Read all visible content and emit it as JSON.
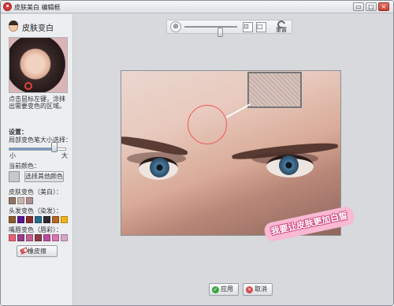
{
  "window": {
    "title": "皮肤美白 编辑框",
    "minimize": "▭",
    "maximize": "□",
    "close": "×"
  },
  "sidebar": {
    "title": "皮肤变白",
    "instruction": "点击鼠标左键，涂抹出需要变色的区域。",
    "settings_label": "设置：",
    "brush_size_label": "局部变色笔大小选择：",
    "brush_size_value": 0.85,
    "small_label": "小",
    "large_label": "大",
    "current_color_label": "当前颜色：",
    "current_color": "#c8c8c8",
    "other_color_button": "选择其他颜色",
    "skin_label": "皮肤变色（美白）：",
    "skin_colors": [
      "#8e7664",
      "#c9b6aa",
      "#ad8e93"
    ],
    "hair_label": "头发变色（染发）：",
    "hair_colors": [
      "#8b5b2c",
      "#5a1590",
      "#8d2c2c",
      "#246b8b",
      "#2f2a30",
      "#b56524",
      "#f0b21c"
    ],
    "lip_label": "嘴唇变色（唇彩）：",
    "lip_colors": [
      "#e46072",
      "#9a3e87",
      "#c5608f",
      "#8e3b4b",
      "#bc4c9f",
      "#da75b5",
      "#d4a7c7"
    ],
    "eraser_label": "橡皮擦"
  },
  "toolbar": {
    "zoom_in_icon": "⊕",
    "zoom_value": 0.7,
    "fit_icon": "⊡",
    "actual_icon": "□",
    "reset_label": "重置"
  },
  "photo": {
    "slogan": "我要让皮肤更加白皙"
  },
  "actions": {
    "apply_label": "应用",
    "cancel_label": "取消"
  }
}
